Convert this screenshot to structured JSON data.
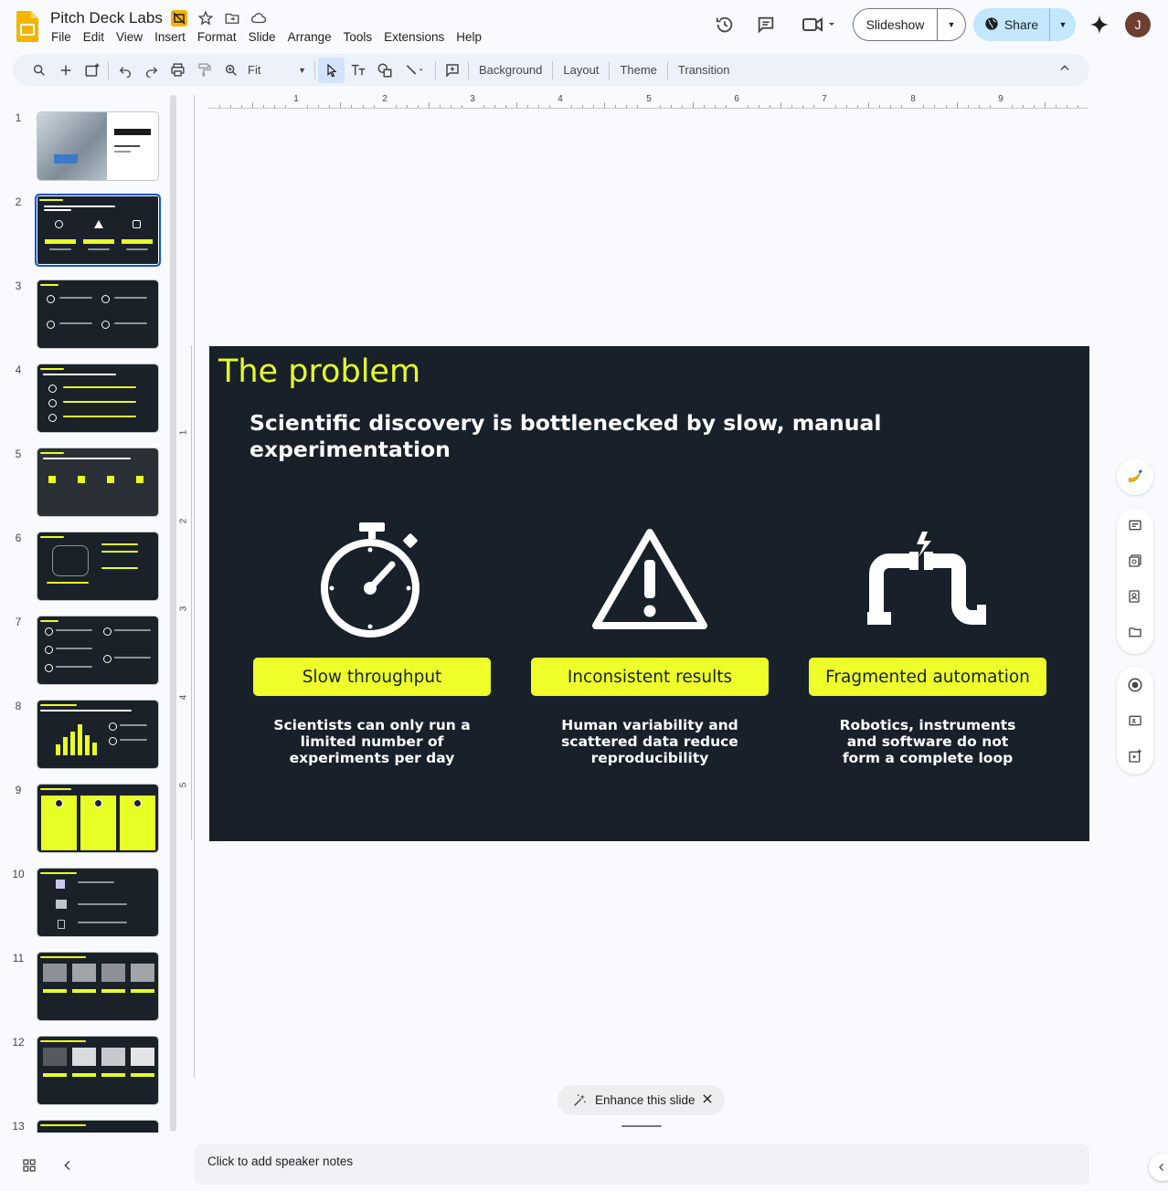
{
  "app": {
    "doc_title": "Pitch Deck Labs",
    "menu": [
      "File",
      "Edit",
      "View",
      "Insert",
      "Format",
      "Slide",
      "Arrange",
      "Tools",
      "Extensions",
      "Help"
    ],
    "slideshow_label": "Slideshow",
    "share_label": "Share",
    "avatar_initial": "J",
    "brand_color": "#0b57d0",
    "logo_color": "#f4b400"
  },
  "toolbar": {
    "zoom_label": "Fit",
    "background_label": "Background",
    "layout_label": "Layout",
    "theme_label": "Theme",
    "transition_label": "Transition"
  },
  "ruler": {
    "h_marks": [
      "1",
      "2",
      "3",
      "4",
      "5",
      "6",
      "7",
      "8",
      "9"
    ],
    "v_marks": [
      "1",
      "2",
      "3",
      "4",
      "5"
    ]
  },
  "filmstrip": {
    "selected": 2,
    "slide_numbers": [
      "1",
      "2",
      "3",
      "4",
      "5",
      "6",
      "7",
      "8",
      "9",
      "10",
      "11",
      "12",
      "13"
    ]
  },
  "slide": {
    "title": "The problem",
    "subtitle": "Scientific discovery is bottlenecked by slow, manual experimentation",
    "bg_color": "#18202a",
    "accent_color": "#eeff2a",
    "columns": [
      {
        "icon": "stopwatch-icon",
        "label": "Slow throughput",
        "description": "Scientists can only run a limited number of experiments per day"
      },
      {
        "icon": "warning-icon",
        "label": "Inconsistent results",
        "description": "Human variability and scattered data reduce reproducibility"
      },
      {
        "icon": "broken-pipe-icon",
        "label": "Fragmented automation",
        "description": "Robotics, instruments and software do not form a complete loop"
      }
    ]
  },
  "enhance": {
    "label": "Enhance this slide"
  },
  "notes": {
    "placeholder": "Click to add speaker notes"
  }
}
